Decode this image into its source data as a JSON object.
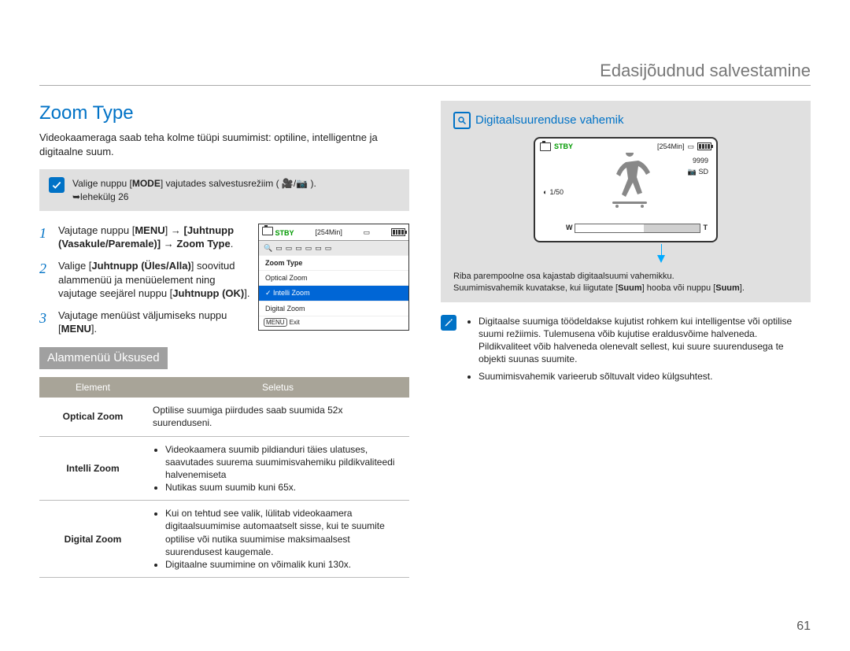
{
  "breadcrumb": "Edasijõudnud salvestamine",
  "page_number": "61",
  "left": {
    "title": "Zoom Type",
    "intro": "Videokaameraga saab teha kolme tüüpi suumimist: optiline, intelligentne ja digitaalne suum.",
    "note_prefix": "Valige nuppu [",
    "note_mode": "MODE",
    "note_mid": "] vajutades salvestusrežiim (",
    "note_suffix": ").",
    "note_ref": "➥lehekülg 26",
    "step1_a": "Vajutage nuppu [",
    "step1_menu": "MENU",
    "step1_b": "] → ",
    "step1_c": "Juhtnupp (Vasakule/Paremale)",
    "step1_d": " → ",
    "step1_e": "Zoom Type",
    "step1_f": ".",
    "step2_a": "Valige [",
    "step2_b": "Juhtnupp (Üles/Alla)",
    "step2_c": "] soovitud alammenüü ja menüüelement ning vajutage seejärel nuppu [",
    "step2_d": "Juhtnupp (OK)",
    "step2_e": "].",
    "step3_a": "Vajutage menüüst väljumiseks nuppu [",
    "step3_b": "MENU",
    "step3_c": "].",
    "menu": {
      "stby": "STBY",
      "min": "[254Min]",
      "title_row": "Zoom Type",
      "opt1": "Optical Zoom",
      "opt2": "Intelli Zoom",
      "opt3": "Digital Zoom",
      "exit_key": "MENU",
      "exit": "Exit"
    },
    "submenu_label": "Alammenüü Üksused",
    "table": {
      "h1": "Element",
      "h2": "Seletus",
      "r1e": "Optical Zoom",
      "r1s": "Optilise suumiga piirdudes saab suumida 52x suurenduseni.",
      "r2e": "Intelli Zoom",
      "r2s1": "Videokaamera suumib pildianduri täies ulatuses, saavutades suurema suumimisvahemiku pildikvaliteedi halvenemiseta",
      "r2s2": "Nutikas suum suumib kuni 65x.",
      "r3e": "Digital Zoom",
      "r3s1": "Kui on tehtud see valik, lülitab videokaamera digitaalsuumimise automaatselt sisse, kui te suumite optilise või nutika suumimise maksimaalsest suurendusest kaugemale.",
      "r3s2": "Digitaalne suumimine on võimalik kuni 130x."
    }
  },
  "right": {
    "title": "Digitaalsuurenduse vahemik",
    "screen": {
      "stby": "STBY",
      "min": "[254Min]",
      "nine": "9999",
      "sd": "SD",
      "speed": "1/50",
      "w": "W",
      "t": "T"
    },
    "desc1": "Riba parempoolne osa kajastab digitaalsuumi vahemikku.",
    "desc2_a": "Suumimisvahemik kuvatakse, kui liigutate [",
    "desc2_b": "Suum",
    "desc2_c": "] hooba või nuppu [",
    "desc2_d": "Suum",
    "desc2_e": "].",
    "notes": {
      "n1": "Digitaalse suumiga töödeldakse kujutist rohkem kui intelligentse või optilise suumi režiimis. Tulemusena võib kujutise eraldusvõime halveneda. Pildikvaliteet võib halveneda olenevalt sellest, kui suure suurendusega te objekti suunas suumite.",
      "n2": "Suumimisvahemik varieerub sõltuvalt video külgsuhtest."
    }
  }
}
